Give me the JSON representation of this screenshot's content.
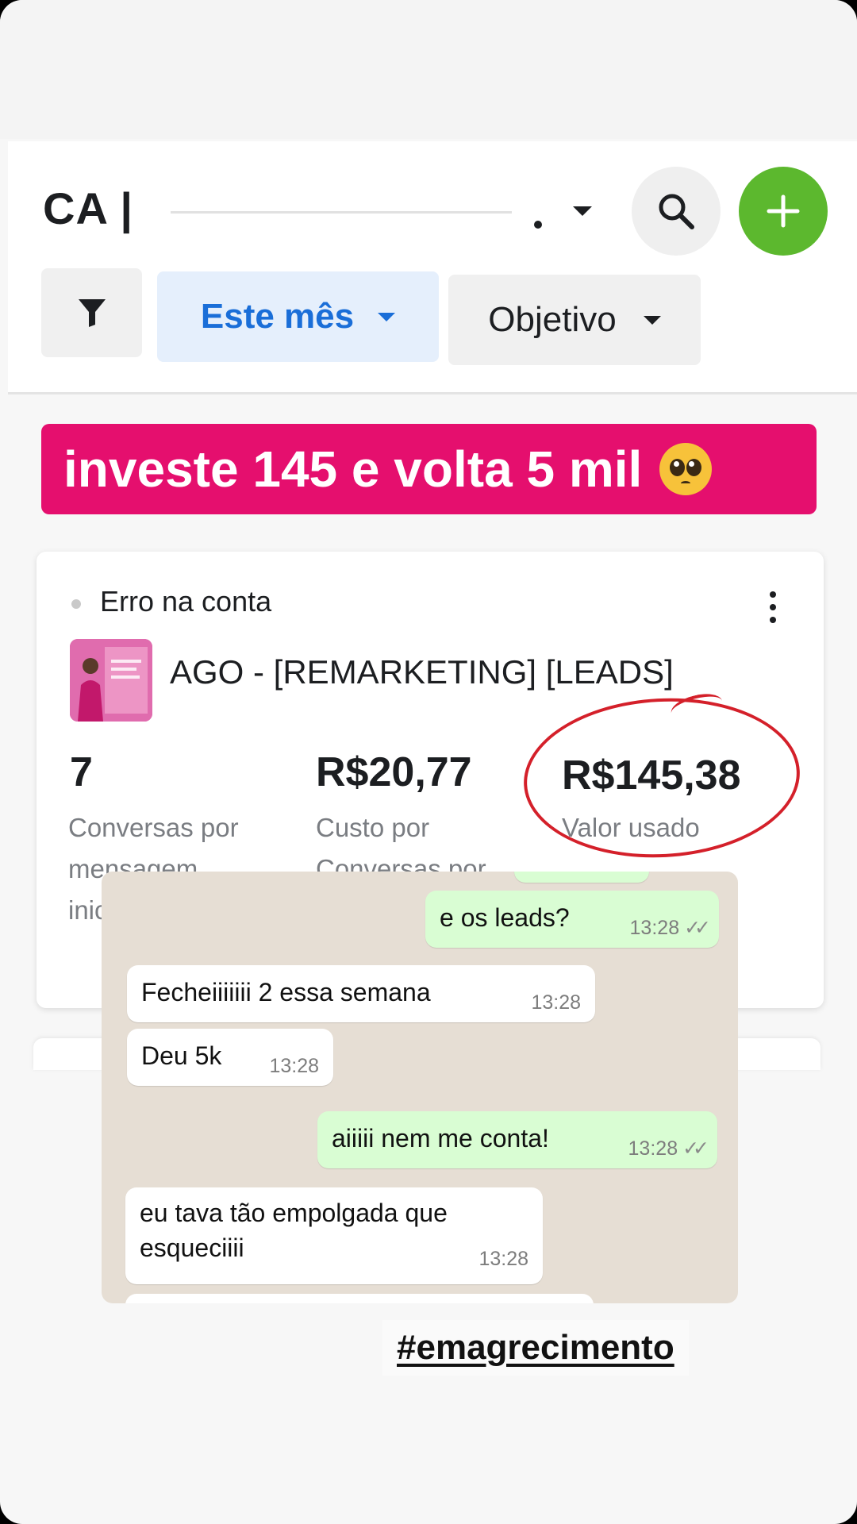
{
  "header": {
    "account_label": "CA |",
    "date_filter_label": "Este mês",
    "objective_filter_label": "Objetivo"
  },
  "banner": {
    "text": "investe 145 e volta 5 mil",
    "emoji": "pleading-face"
  },
  "card": {
    "status": "Erro na conta",
    "campaign_name": "AGO - [REMARKETING] [LEADS]",
    "metrics": [
      {
        "value": "7",
        "label_line1": "Conversas por",
        "label_line2": "mensagem",
        "label_line3": "inic"
      },
      {
        "value": "R$20,77",
        "label_line1": "Custo por",
        "label_line2": "Conversas por"
      },
      {
        "value": "R$145,38",
        "label_line1": "Valor usado"
      }
    ]
  },
  "chat": {
    "messages": [
      {
        "direction": "out",
        "text": "e os leads?",
        "time": "13:28",
        "read": true
      },
      {
        "direction": "in",
        "text": "Fecheiiiiiii 2 essa semana",
        "time": "13:28"
      },
      {
        "direction": "in",
        "text": "Deu 5k",
        "time": "13:28"
      },
      {
        "direction": "out",
        "text": "aiiiii nem me conta!",
        "time": "13:28",
        "read": true
      },
      {
        "direction": "in",
        "text_line1": "eu tava tão empolgada que",
        "text_line2": "esqueciiii",
        "time": "13:28"
      }
    ]
  },
  "hashtag": "#emagrecimento",
  "colors": {
    "banner_bg": "#e50f6e",
    "add_button": "#5cb82e",
    "date_filter_text": "#1a6ed8",
    "annotation_circle": "#d4202a",
    "chat_out_bubble": "#d9fdd3"
  }
}
